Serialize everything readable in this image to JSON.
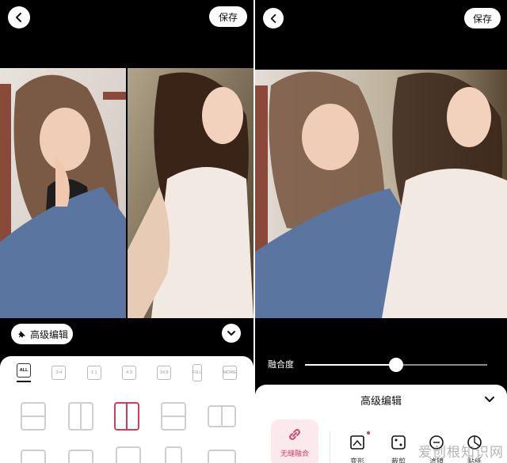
{
  "left_screen": {
    "save_label": "保存",
    "advanced_edit_label": "高级编辑",
    "ratios": [
      "ALL",
      "3:4",
      "1:1",
      "4:3",
      "16:9",
      "FULL",
      "MORE"
    ],
    "selected_ratio": "ALL",
    "selected_layout_index": 2
  },
  "right_screen": {
    "save_label": "保存",
    "blend_label": "融合度",
    "blend_value": 0.5,
    "panel_title": "高级编辑",
    "tools": [
      {
        "label": "无缝融合",
        "icon": "link-icon"
      },
      {
        "label": "变形",
        "icon": "shape-icon"
      },
      {
        "label": "裁剪",
        "icon": "crop-icon"
      },
      {
        "label": "滤镜",
        "icon": "filter-icon"
      },
      {
        "label": "贴纸",
        "icon": "sticker-icon"
      }
    ],
    "watermark": "爱创根知识网"
  },
  "colors": {
    "accent": "#d63a5e",
    "accent_bg": "#fbe9ee",
    "screen_bg": "#000000"
  }
}
